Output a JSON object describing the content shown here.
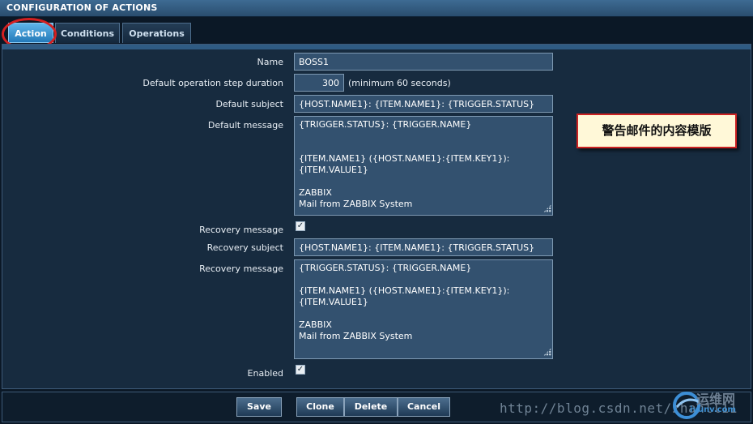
{
  "window": {
    "title": "CONFIGURATION OF ACTIONS"
  },
  "tabs": [
    {
      "label": "Action",
      "active": true
    },
    {
      "label": "Conditions",
      "active": false
    },
    {
      "label": "Operations",
      "active": false
    }
  ],
  "form": {
    "name_label": "Name",
    "name_value": "BOSS1",
    "step_duration_label": "Default operation step duration",
    "step_duration_value": "300",
    "step_duration_hint": "(minimum 60 seconds)",
    "default_subject_label": "Default subject",
    "default_subject_value": "{HOST.NAME1}: {ITEM.NAME1}: {TRIGGER.STATUS}",
    "default_message_label": "Default message",
    "default_message_value": "{TRIGGER.STATUS}: {TRIGGER.NAME}\n\n\n{ITEM.NAME1} ({HOST.NAME1}:{ITEM.KEY1}):\n{ITEM.VALUE1}\n\nZABBIX\nMail from ZABBIX System",
    "recovery_message_checkbox_label": "Recovery message",
    "recovery_message_checked": true,
    "recovery_subject_label": "Recovery subject",
    "recovery_subject_value": "{HOST.NAME1}: {ITEM.NAME1}: {TRIGGER.STATUS}",
    "recovery_message_label": "Recovery message",
    "recovery_message_value": "{TRIGGER.STATUS}: {TRIGGER.NAME}\n\n{ITEM.NAME1} ({HOST.NAME1}:{ITEM.KEY1}):\n{ITEM.VALUE1}\n\nZABBIX\nMail from ZABBIX System",
    "enabled_label": "Enabled",
    "enabled_checked": true
  },
  "callout": {
    "text": "警告邮件的内容模版"
  },
  "buttons": {
    "save": "Save",
    "clone": "Clone",
    "delete": "Delete",
    "cancel": "Cancel"
  },
  "watermark": {
    "url": "http://blog.csdn.net/zhanll11",
    "logo_text": "运维网",
    "logo_sub": "iyunv.com"
  },
  "colors": {
    "active_tab": "#2f8fd0",
    "annotation_ring": "#d42020",
    "callout_border": "#cc2222"
  }
}
